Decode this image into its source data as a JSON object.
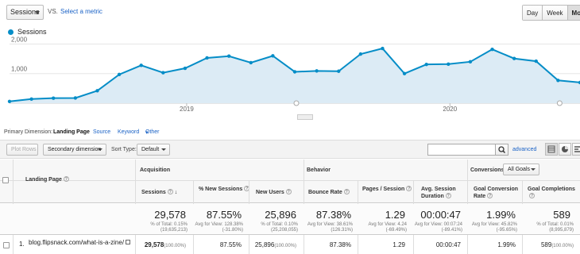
{
  "toolbar": {
    "metric_select": "Sessions",
    "vs": "VS.",
    "select_metric": "Select a metric",
    "periods": [
      "Day",
      "Week",
      "Month"
    ],
    "active_period": "Month"
  },
  "chart_data": {
    "type": "area",
    "series": [
      {
        "name": "Sessions",
        "values": [
          60,
          140,
          170,
          175,
          420,
          970,
          1280,
          1030,
          1180,
          1530,
          1590,
          1370,
          1600,
          1060,
          1090,
          1080,
          1660,
          1850,
          1000,
          1310,
          1320,
          1400,
          1820,
          1510,
          1420,
          770,
          700
        ]
      }
    ],
    "y_ticks": [
      "1,000",
      "2,000"
    ],
    "ylim": [
      0,
      2200
    ],
    "x_labels": [
      "2019",
      "2020"
    ],
    "grid": true,
    "color": "#058dc7",
    "fill": "#dcebf5"
  },
  "dimension": {
    "label": "Primary Dimension:",
    "active": "Landing Page",
    "options": [
      "Source",
      "Keyword",
      "Other"
    ]
  },
  "controls": {
    "plot_rows": "Plot Rows",
    "secondary_dimension": "Secondary dimension",
    "sort_type_label": "Sort Type:",
    "sort_type": "Default",
    "advanced": "advanced"
  },
  "table": {
    "groups": {
      "acquisition": "Acquisition",
      "behavior": "Behavior",
      "conversions": "Conversions",
      "goal_select": "All Goals"
    },
    "headers": {
      "landing_page": "Landing Page",
      "sessions": "Sessions",
      "new_sessions": "% New Sessions",
      "new_users": "New Users",
      "bounce_rate": "Bounce Rate",
      "pages_session": "Pages / Session",
      "avg_duration": "Avg. Session Duration",
      "goal_conv": "Goal Conversion Rate",
      "goal_completions": "Goal Completions"
    },
    "totals": {
      "sessions": "29,578",
      "sessions_sub": "% of Total: 0.15% (19,635,213)",
      "new_sessions": "87.55%",
      "new_sessions_sub": "Avg for View: 128.38% (-31.80%)",
      "new_users": "25,896",
      "new_users_sub": "% of Total: 0.10% (25,208,055)",
      "bounce_rate": "87.38%",
      "bounce_rate_sub": "Avg for View: 38.61% (126.31%)",
      "pages_session": "1.29",
      "pages_session_sub": "Avg for View: 4.24 (-69.49%)",
      "avg_duration": "00:00:47",
      "avg_duration_sub": "Avg for View: 00:07:24 (-89.41%)",
      "goal_conv": "1.99%",
      "goal_conv_sub": "Avg for View: 45.82% (-95.65%)",
      "goal_completions": "589",
      "goal_completions_sub": "% of Total: 0.01% (8,995,879)"
    },
    "rows": [
      {
        "num": "1.",
        "landing_page": "blog.flipsnack.com/what-is-a-zine/",
        "sessions": "29,578",
        "sessions_pct": "(100.00%)",
        "new_sessions": "87.55%",
        "new_users": "25,896",
        "new_users_pct": "(100.00%)",
        "bounce_rate": "87.38%",
        "pages_session": "1.29",
        "avg_duration": "00:00:47",
        "goal_conv": "1.99%",
        "goal_completions": "589",
        "goal_completions_pct": "(100.00%)"
      }
    ]
  }
}
